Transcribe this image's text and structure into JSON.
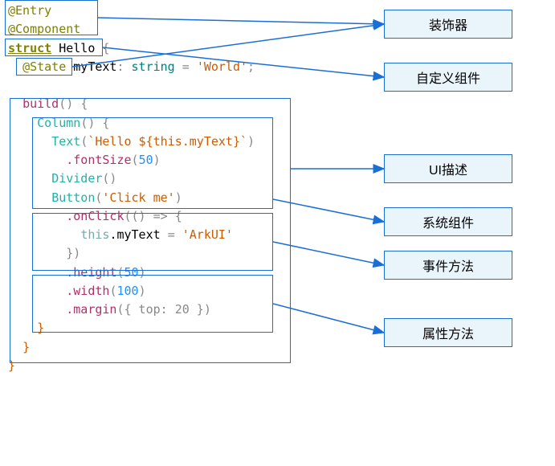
{
  "code": {
    "entry": "@Entry",
    "component": "@Component",
    "struct": "struct",
    "structName": "Hello",
    "brace_open": "{",
    "state": "@State",
    "field": "myText",
    "colon": ":",
    "fieldType": "string",
    "eq": "=",
    "fieldVal": "'World'",
    "semi": ";",
    "build": "build",
    "parens": "()",
    "column": "Column",
    "text": "Text",
    "textArg": "`Hello ${this.myText}`",
    "fontSize": ".fontSize",
    "fontSizeArg": "50",
    "divider": "Divider",
    "button": "Button",
    "buttonArg": "'Click me'",
    "onClick": ".onClick",
    "arrow": "(() => {",
    "assignThis": "this",
    "assignDot": ".myText",
    "assignEq": "=",
    "assignVal": "'ArkUI'",
    "onClickEnd": "})",
    "height": ".height",
    "heightArg": "50",
    "width": ".width",
    "widthArg": "100",
    "margin": ".margin",
    "marginArg": "({ top: 20 })"
  },
  "labels": {
    "decorator": "装饰器",
    "customComponent": "自定义组件",
    "uiDesc": "UI描述",
    "sysComponent": "系统组件",
    "eventMethod": "事件方法",
    "attrMethod": "属性方法"
  }
}
